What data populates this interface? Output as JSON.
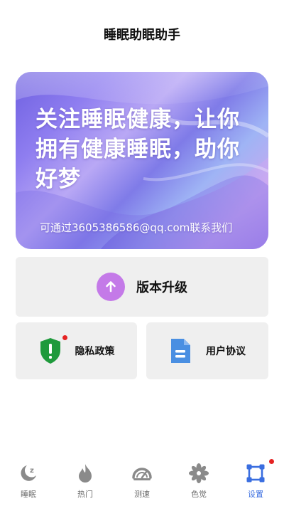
{
  "header": {
    "title": "睡眠助眠助手"
  },
  "banner": {
    "slogan": "关注睡眠健康，让你拥有健康睡眠，助你好梦",
    "contact": "可通过3605386586@qq.com联系我们"
  },
  "cards": {
    "upgrade": {
      "label": "版本升级",
      "icon": "arrow-up-icon",
      "color": "#c47ae8"
    },
    "privacy": {
      "label": "隐私政策",
      "icon": "shield-alert-icon",
      "color": "#1f9a3c",
      "has_badge": true
    },
    "agreement": {
      "label": "用户协议",
      "icon": "document-icon",
      "color": "#4a8fe2"
    }
  },
  "tabbar": {
    "tabs": [
      {
        "label": "睡眠",
        "icon": "moon-zz-icon",
        "active": false
      },
      {
        "label": "热门",
        "icon": "flame-icon",
        "active": false
      },
      {
        "label": "测速",
        "icon": "speedometer-icon",
        "active": false
      },
      {
        "label": "色觉",
        "icon": "flower-icon",
        "active": false
      },
      {
        "label": "设置",
        "icon": "settings-frame-icon",
        "active": true,
        "has_badge": true
      }
    ],
    "active_color": "#3a6ee0",
    "inactive_color": "#6b6b6b"
  }
}
